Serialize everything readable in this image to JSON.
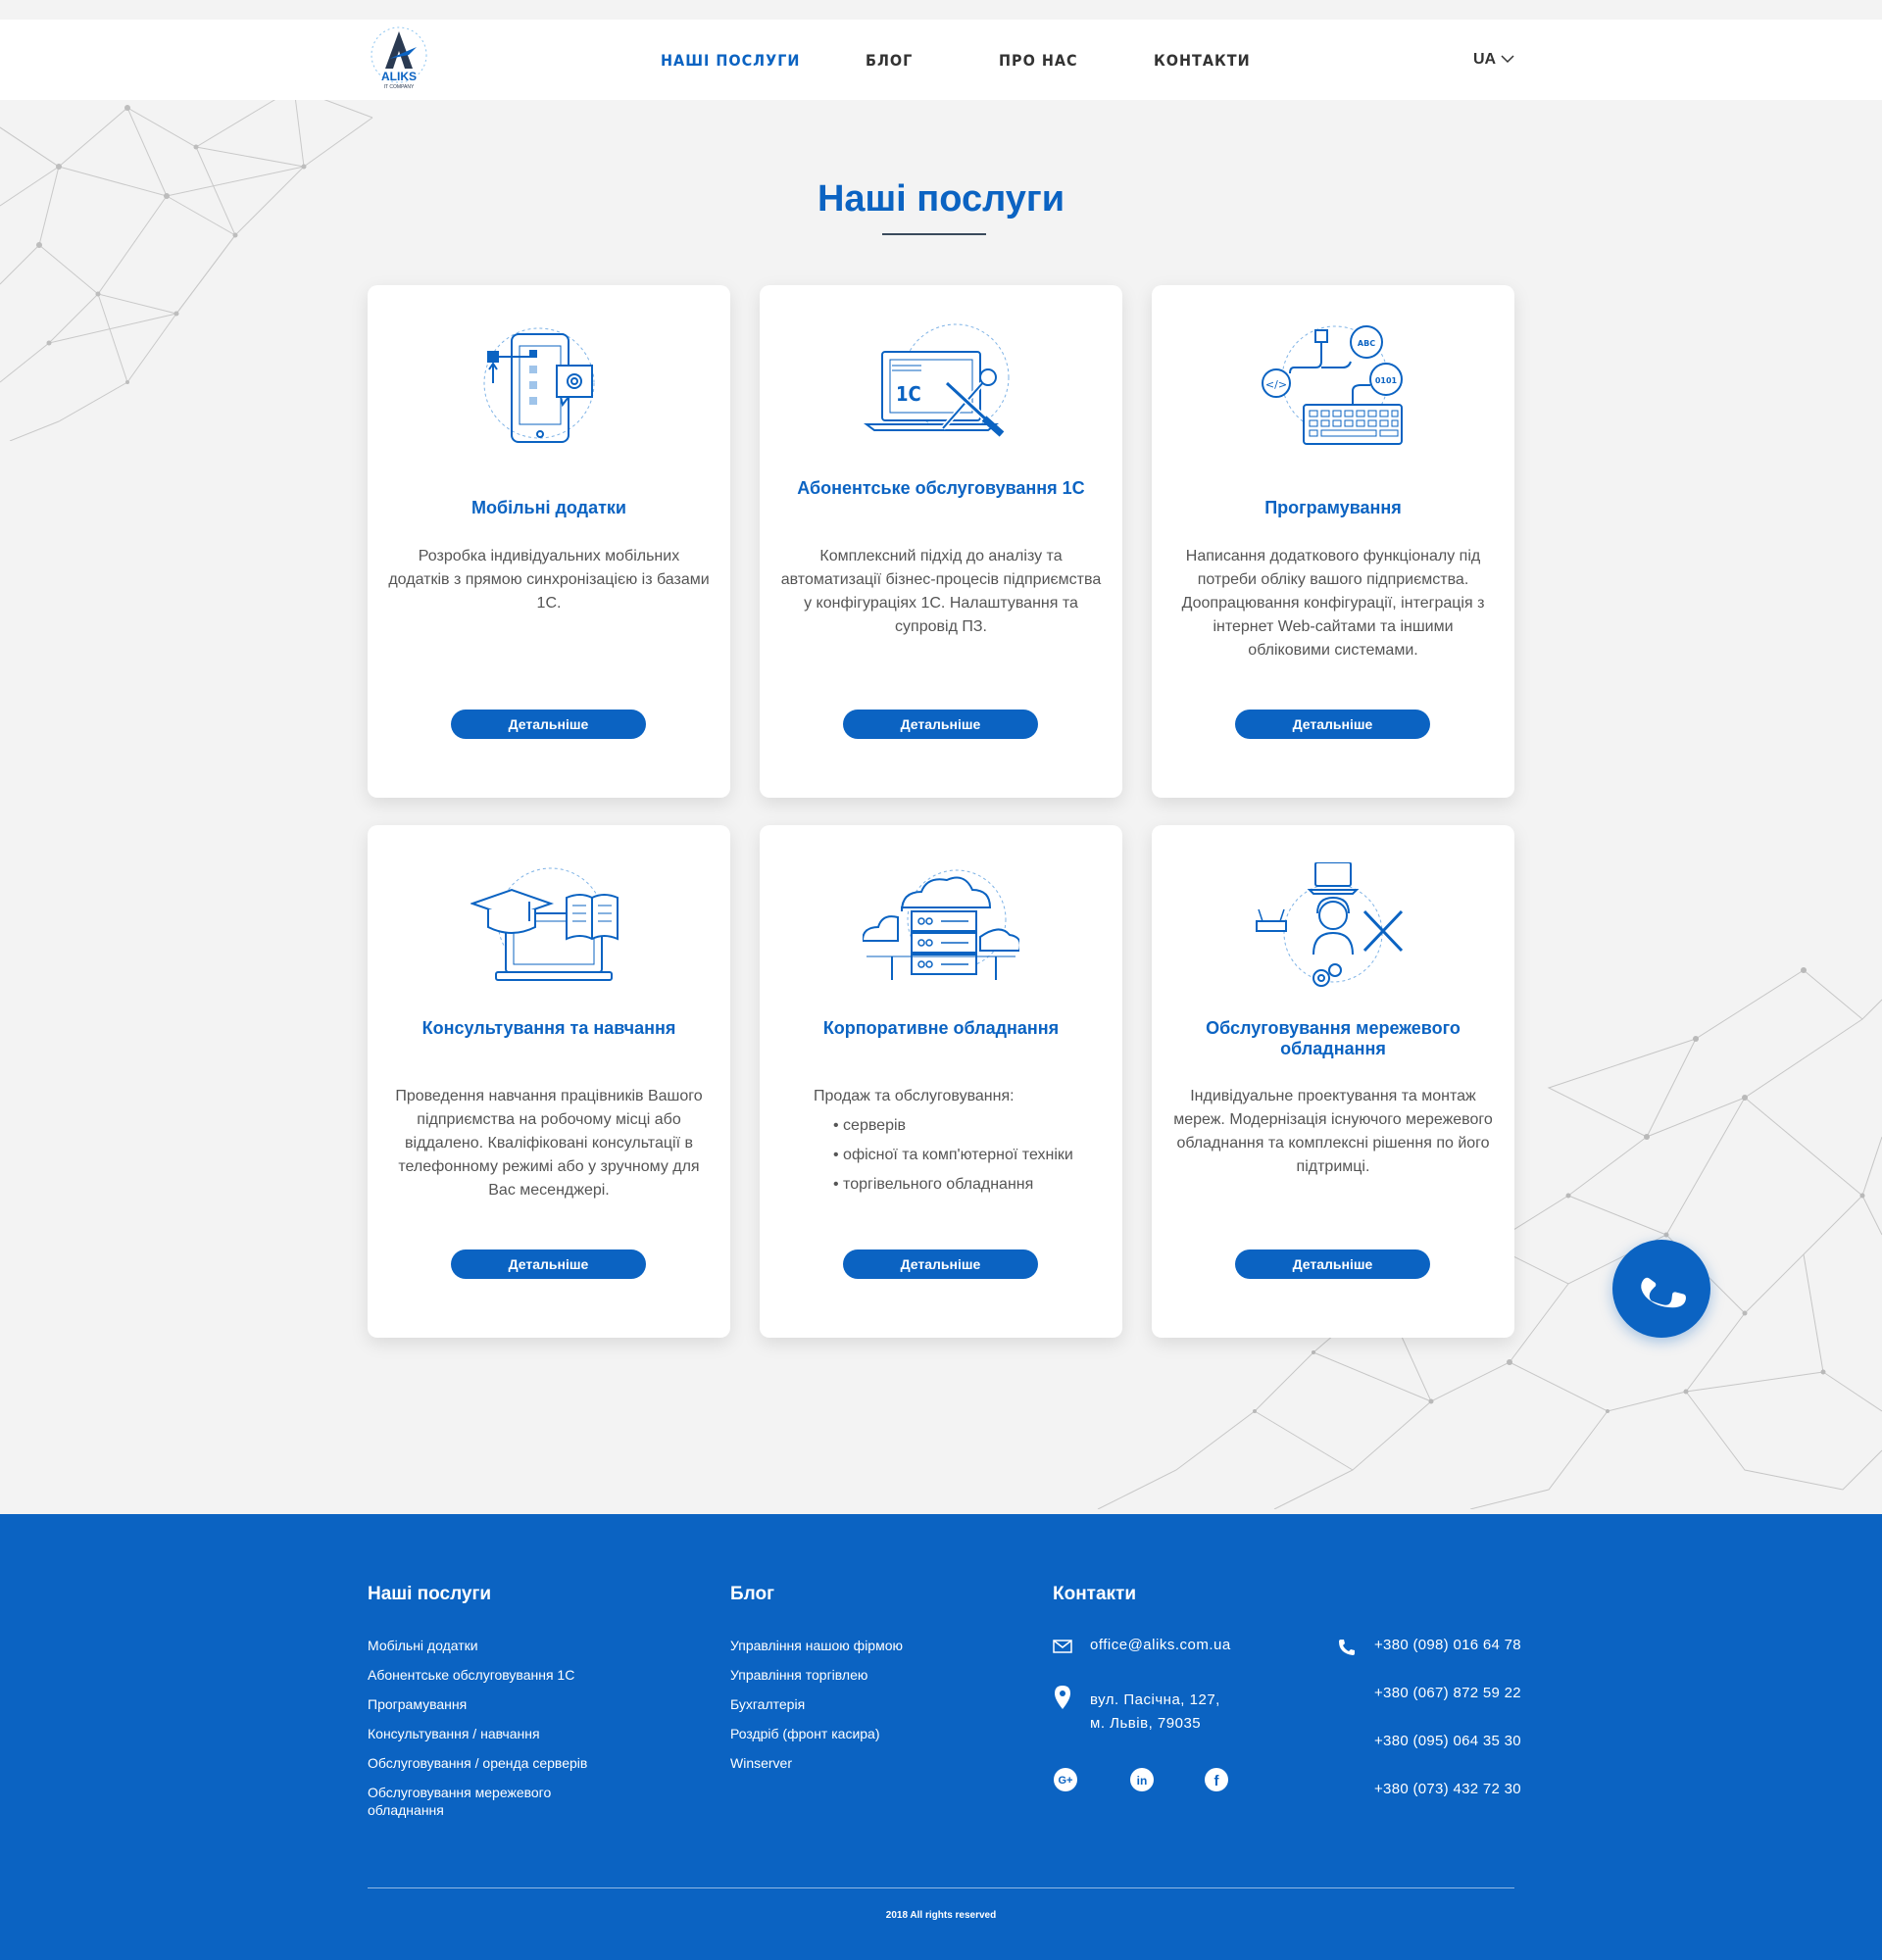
{
  "colors": {
    "brand": "#0b63c2",
    "bg": "#f3f3f3",
    "text": "#555555"
  },
  "header": {
    "logo_icon": "aliks-logo",
    "logo_text": "ALIKS",
    "logo_subtext": "IT COMPANY",
    "nav": [
      "НАШІ ПОСЛУГИ",
      "БЛОГ",
      "ПРО НАС",
      "КОНТАКТИ"
    ],
    "active_nav": "НАШІ ПОСЛУГИ",
    "lang": "UA"
  },
  "main": {
    "title": "Наші послуги",
    "cards": [
      {
        "title": "Мобільні додатки",
        "desc": "Розробка індивідуальних мобільних додатків з прямою синхронізацією із базами 1С.",
        "button": "Детальніше",
        "icon": "mobile-app-icon"
      },
      {
        "title": "Абонентське обслуговування 1С",
        "desc": "Комплексний підхід до аналізу та автоматизації бізнес-процесів підприємства у конфігураціях 1С. Налаштування та  супровід ПЗ.",
        "button": "Детальніше",
        "icon": "laptop-tools-icon",
        "icon_label": "1C"
      },
      {
        "title": "Програмування",
        "desc": "Написання додаткового функціоналу під потреби обліку вашого підприємства. Доопрацювання конфігурації, інтеграція з інтернет Web-сайтами та іншими обліковими системами.",
        "button": "Детальніше",
        "icon": "keyboard-code-icon",
        "icon_labels": [
          "ABC",
          "0101",
          "</>"
        ]
      },
      {
        "title": "Консультування та навчання",
        "desc": "Проведення навчання працівників Вашого підприємства на робочому місці або віддалено. Кваліфіковані консультації в телефонному режимі або у зручному для Вас месенджері.",
        "button": "Детальніше",
        "icon": "education-icon"
      },
      {
        "title": "Корпоративне обладнання",
        "desc": "Продаж та обслуговування:",
        "list": [
          "серверів",
          "офісної та комп'ютерної техніки",
          "торгівельного обладнання"
        ],
        "button": "Детальніше",
        "icon": "server-cloud-icon"
      },
      {
        "title": "Обслуговування мережевого обладнання",
        "desc": "Індивідуальне проектування та монтаж мереж. Модернізація існуючого мережевого обладнання та комплексні рішення по його підтримці.",
        "button": "Детальніше",
        "icon": "network-support-icon"
      }
    ]
  },
  "footer": {
    "services_title": "Наші послуги",
    "services": [
      "Мобільні додатки",
      "Абонентське обслуговування 1С",
      "Програмування",
      "Консультування / навчання",
      "Обслуговування / оренда серверів",
      "Обслуговування мережевого обладнання"
    ],
    "blog_title": "Блог",
    "blog": [
      "Управління нашою фірмою",
      "Управління торгівлею",
      "Бухгалтерія",
      "Роздріб (фронт касира)",
      "Winserver"
    ],
    "contacts_title": "Контакти",
    "email": "office@aliks.com.ua",
    "address_line1": "вул. Пасічна, 127,",
    "address_line2": "м. Львів, 79035",
    "phones": [
      "+380 (098) 016 64 78",
      "+380 (067) 872 59 22",
      "+380 (095) 064 35 30",
      "+380 (073) 432 72 30"
    ],
    "social": [
      "google-plus-icon",
      "linkedin-icon",
      "facebook-icon"
    ],
    "copyright": "2018 All rights reserved"
  }
}
